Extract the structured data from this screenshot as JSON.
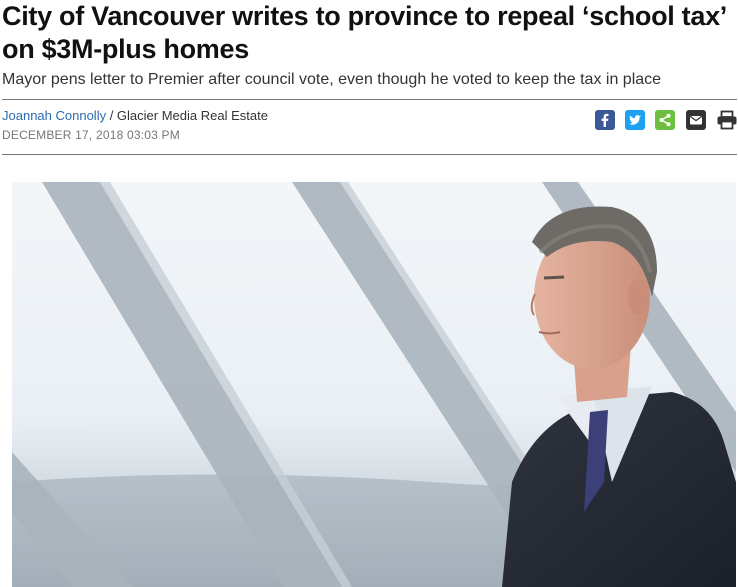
{
  "article": {
    "headline": "City of Vancouver writes to province to repeal ‘school tax’ on $3M-plus homes",
    "dek": "Mayor pens letter to Premier after council vote, even though he voted to keep the tax in place",
    "author": "Joannah Connolly",
    "byline_separator": " / ",
    "publication": "Glacier Media Real Estate",
    "dateline": "DECEMBER 17, 2018 03:03 PM"
  },
  "share_bar": {
    "items": [
      {
        "name": "facebook-icon",
        "color": "#3b5998"
      },
      {
        "name": "twitter-icon",
        "color": "#1da1f2"
      },
      {
        "name": "share-icon",
        "color": "#6cbf3f"
      },
      {
        "name": "email-icon",
        "color": "#333333"
      },
      {
        "name": "print-icon",
        "color": "#333333"
      }
    ]
  },
  "hero_image": {
    "subject": "man in suit looking out a window with diagonal frames"
  }
}
